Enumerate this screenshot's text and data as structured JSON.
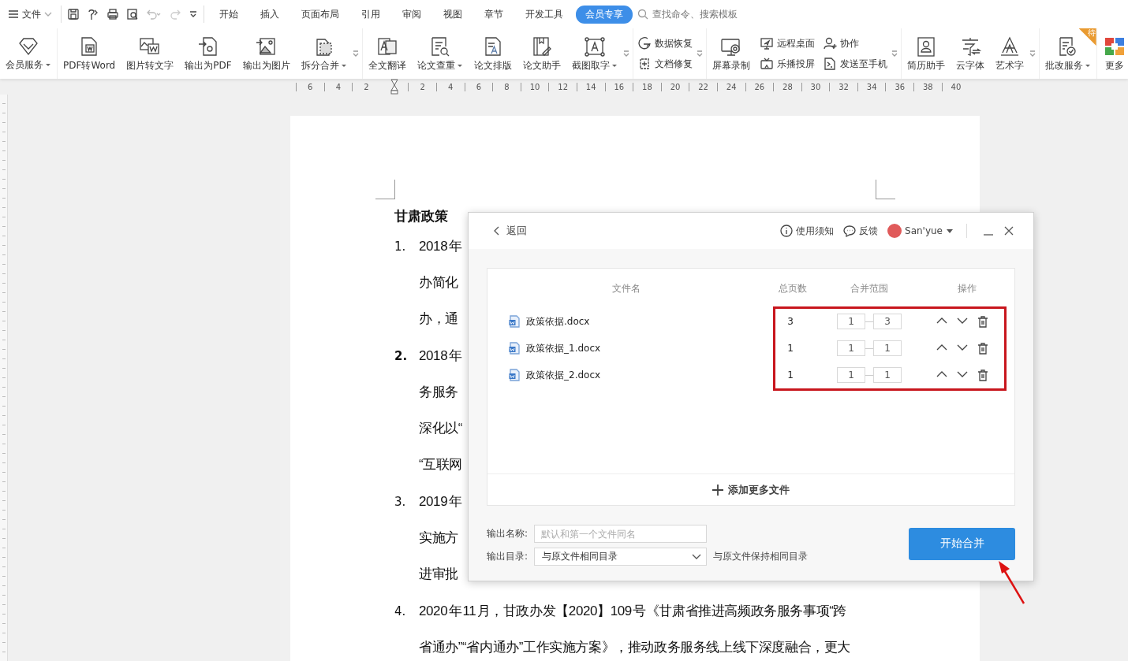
{
  "menubar": {
    "file_menu": "文件",
    "tabs": [
      {
        "label": "开始",
        "selected": false
      },
      {
        "label": "插入",
        "selected": false
      },
      {
        "label": "页面布局",
        "selected": false
      },
      {
        "label": "引用",
        "selected": false
      },
      {
        "label": "审阅",
        "selected": false
      },
      {
        "label": "视图",
        "selected": false
      },
      {
        "label": "章节",
        "selected": false
      },
      {
        "label": "开发工具",
        "selected": false
      },
      {
        "label": "会员专享",
        "selected": true
      }
    ],
    "search": {
      "placeholder": "查找命令、搜索模板"
    }
  },
  "ribbon": {
    "groups": [
      {
        "more_arrow": false,
        "items": [
          {
            "label": "会员服务",
            "kind": "large",
            "dropdown": true
          }
        ]
      },
      {
        "more_arrow": true,
        "items": [
          {
            "label": "PDF转Word",
            "kind": "large",
            "dropdown": false
          },
          {
            "label": "图片转文字",
            "kind": "large",
            "dropdown": false
          },
          {
            "label": "输出为PDF",
            "kind": "large",
            "dropdown": false
          },
          {
            "label": "输出为图片",
            "kind": "large",
            "dropdown": false
          },
          {
            "label": "拆分合并",
            "kind": "large",
            "dropdown": true
          }
        ]
      },
      {
        "more_arrow": true,
        "items": [
          {
            "label": "全文翻译",
            "kind": "large",
            "dropdown": false
          },
          {
            "label": "论文查重",
            "kind": "large",
            "dropdown": true
          },
          {
            "label": "论文排版",
            "kind": "large",
            "dropdown": false
          },
          {
            "label": "论文助手",
            "kind": "large",
            "dropdown": false
          },
          {
            "label": "截图取字",
            "kind": "large",
            "dropdown": true
          }
        ]
      },
      {
        "more_arrow": true,
        "items": [
          {
            "label": "数据恢复",
            "kind": "small",
            "dropdown": false
          },
          {
            "label": "文档修复",
            "kind": "small",
            "dropdown": false
          }
        ]
      },
      {
        "more_arrow": true,
        "items": [
          {
            "label": "屏幕录制",
            "kind": "large",
            "dropdown": false
          },
          {
            "label": "远程桌面",
            "kind": "small",
            "dropdown": false
          },
          {
            "label": "乐播投屏",
            "kind": "small",
            "dropdown": false
          },
          {
            "label": "协作",
            "kind": "small",
            "dropdown": false
          },
          {
            "label": "发送至手机",
            "kind": "small",
            "dropdown": false
          }
        ]
      },
      {
        "more_arrow": true,
        "items": [
          {
            "label": "简历助手",
            "kind": "large",
            "dropdown": false
          },
          {
            "label": "云字体",
            "kind": "large",
            "dropdown": false
          },
          {
            "label": "艺术字",
            "kind": "large",
            "dropdown": false
          }
        ]
      },
      {
        "more_arrow": false,
        "items": [
          {
            "label": "批改服务",
            "kind": "large",
            "dropdown": true,
            "badge": "待"
          }
        ]
      },
      {
        "more_arrow": false,
        "items": [
          {
            "label": "更多",
            "kind": "large",
            "dropdown": false
          }
        ]
      }
    ]
  },
  "ruler": {
    "left_labels": [
      "6",
      "4",
      "2"
    ],
    "right_labels": [
      "2",
      "4",
      "6",
      "8",
      "10",
      "12",
      "14",
      "16",
      "18",
      "20",
      "22",
      "24",
      "26",
      "28",
      "30",
      "32",
      "34",
      "36",
      "38",
      "40"
    ]
  },
  "document": {
    "title": "甘肃政策",
    "items": [
      {
        "number": "1.",
        "number_bold": false,
        "lines": [
          "2018 年",
          "办简化",
          "办，通"
        ]
      },
      {
        "number": "2.",
        "number_bold": true,
        "lines": [
          "2018 年",
          "务服务",
          "深化以“",
          "“互联网"
        ]
      },
      {
        "number": "3.",
        "number_bold": false,
        "lines": [
          "2019 年",
          "实施方",
          "进审批"
        ]
      },
      {
        "number": "4.",
        "number_bold": false,
        "lines": [
          "2020 年 11 月，甘政办发【2020】109 号《甘肃省推进高频政务服务事项“跨",
          "省通办”“省内通办”工作实施方案》，推动政务服务线上线下深度融合，更大"
        ]
      }
    ]
  },
  "dialog": {
    "back": "返回",
    "notice": "使用须知",
    "feedback": "反馈",
    "user": "San'yue",
    "columns": [
      "文件名",
      "总页数",
      "合并范围",
      "操作"
    ],
    "files": [
      {
        "name": "政策依据.docx",
        "pages": "3",
        "from": "1",
        "to": "3"
      },
      {
        "name": "政策依据_1.docx",
        "pages": "1",
        "from": "1",
        "to": "1"
      },
      {
        "name": "政策依据_2.docx",
        "pages": "1",
        "from": "1",
        "to": "1"
      }
    ],
    "add_more": "添加更多文件",
    "output_name": {
      "label": "输出名称:",
      "placeholder": "默认和第一个文件同名"
    },
    "output_dir": {
      "label": "输出目录:",
      "value": "与原文件相同目录",
      "note": "与原文件保持相同目录"
    },
    "start_button": "开始合并"
  },
  "annotation": {
    "highlight_box": true,
    "arrow": true
  }
}
